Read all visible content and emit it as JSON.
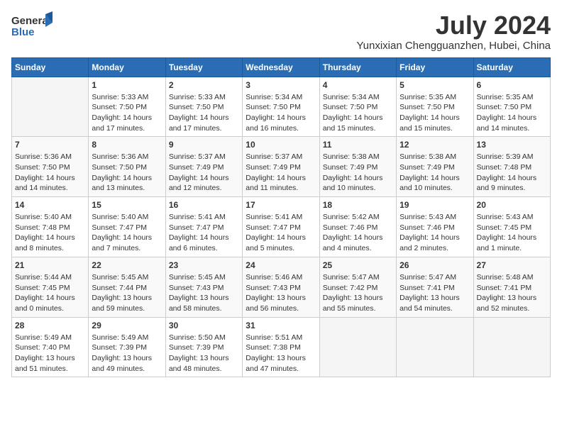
{
  "header": {
    "logo_general": "General",
    "logo_blue": "Blue",
    "title": "July 2024",
    "subtitle": "Yunxixian Chengguanzhen, Hubei, China"
  },
  "calendar": {
    "weekdays": [
      "Sunday",
      "Monday",
      "Tuesday",
      "Wednesday",
      "Thursday",
      "Friday",
      "Saturday"
    ],
    "weeks": [
      [
        {
          "day": "",
          "info": ""
        },
        {
          "day": "1",
          "info": "Sunrise: 5:33 AM\nSunset: 7:50 PM\nDaylight: 14 hours\nand 17 minutes."
        },
        {
          "day": "2",
          "info": "Sunrise: 5:33 AM\nSunset: 7:50 PM\nDaylight: 14 hours\nand 17 minutes."
        },
        {
          "day": "3",
          "info": "Sunrise: 5:34 AM\nSunset: 7:50 PM\nDaylight: 14 hours\nand 16 minutes."
        },
        {
          "day": "4",
          "info": "Sunrise: 5:34 AM\nSunset: 7:50 PM\nDaylight: 14 hours\nand 15 minutes."
        },
        {
          "day": "5",
          "info": "Sunrise: 5:35 AM\nSunset: 7:50 PM\nDaylight: 14 hours\nand 15 minutes."
        },
        {
          "day": "6",
          "info": "Sunrise: 5:35 AM\nSunset: 7:50 PM\nDaylight: 14 hours\nand 14 minutes."
        }
      ],
      [
        {
          "day": "7",
          "info": "Sunrise: 5:36 AM\nSunset: 7:50 PM\nDaylight: 14 hours\nand 14 minutes."
        },
        {
          "day": "8",
          "info": "Sunrise: 5:36 AM\nSunset: 7:50 PM\nDaylight: 14 hours\nand 13 minutes."
        },
        {
          "day": "9",
          "info": "Sunrise: 5:37 AM\nSunset: 7:49 PM\nDaylight: 14 hours\nand 12 minutes."
        },
        {
          "day": "10",
          "info": "Sunrise: 5:37 AM\nSunset: 7:49 PM\nDaylight: 14 hours\nand 11 minutes."
        },
        {
          "day": "11",
          "info": "Sunrise: 5:38 AM\nSunset: 7:49 PM\nDaylight: 14 hours\nand 10 minutes."
        },
        {
          "day": "12",
          "info": "Sunrise: 5:38 AM\nSunset: 7:49 PM\nDaylight: 14 hours\nand 10 minutes."
        },
        {
          "day": "13",
          "info": "Sunrise: 5:39 AM\nSunset: 7:48 PM\nDaylight: 14 hours\nand 9 minutes."
        }
      ],
      [
        {
          "day": "14",
          "info": "Sunrise: 5:40 AM\nSunset: 7:48 PM\nDaylight: 14 hours\nand 8 minutes."
        },
        {
          "day": "15",
          "info": "Sunrise: 5:40 AM\nSunset: 7:47 PM\nDaylight: 14 hours\nand 7 minutes."
        },
        {
          "day": "16",
          "info": "Sunrise: 5:41 AM\nSunset: 7:47 PM\nDaylight: 14 hours\nand 6 minutes."
        },
        {
          "day": "17",
          "info": "Sunrise: 5:41 AM\nSunset: 7:47 PM\nDaylight: 14 hours\nand 5 minutes."
        },
        {
          "day": "18",
          "info": "Sunrise: 5:42 AM\nSunset: 7:46 PM\nDaylight: 14 hours\nand 4 minutes."
        },
        {
          "day": "19",
          "info": "Sunrise: 5:43 AM\nSunset: 7:46 PM\nDaylight: 14 hours\nand 2 minutes."
        },
        {
          "day": "20",
          "info": "Sunrise: 5:43 AM\nSunset: 7:45 PM\nDaylight: 14 hours\nand 1 minute."
        }
      ],
      [
        {
          "day": "21",
          "info": "Sunrise: 5:44 AM\nSunset: 7:45 PM\nDaylight: 14 hours\nand 0 minutes."
        },
        {
          "day": "22",
          "info": "Sunrise: 5:45 AM\nSunset: 7:44 PM\nDaylight: 13 hours\nand 59 minutes."
        },
        {
          "day": "23",
          "info": "Sunrise: 5:45 AM\nSunset: 7:43 PM\nDaylight: 13 hours\nand 58 minutes."
        },
        {
          "day": "24",
          "info": "Sunrise: 5:46 AM\nSunset: 7:43 PM\nDaylight: 13 hours\nand 56 minutes."
        },
        {
          "day": "25",
          "info": "Sunrise: 5:47 AM\nSunset: 7:42 PM\nDaylight: 13 hours\nand 55 minutes."
        },
        {
          "day": "26",
          "info": "Sunrise: 5:47 AM\nSunset: 7:41 PM\nDaylight: 13 hours\nand 54 minutes."
        },
        {
          "day": "27",
          "info": "Sunrise: 5:48 AM\nSunset: 7:41 PM\nDaylight: 13 hours\nand 52 minutes."
        }
      ],
      [
        {
          "day": "28",
          "info": "Sunrise: 5:49 AM\nSunset: 7:40 PM\nDaylight: 13 hours\nand 51 minutes."
        },
        {
          "day": "29",
          "info": "Sunrise: 5:49 AM\nSunset: 7:39 PM\nDaylight: 13 hours\nand 49 minutes."
        },
        {
          "day": "30",
          "info": "Sunrise: 5:50 AM\nSunset: 7:39 PM\nDaylight: 13 hours\nand 48 minutes."
        },
        {
          "day": "31",
          "info": "Sunrise: 5:51 AM\nSunset: 7:38 PM\nDaylight: 13 hours\nand 47 minutes."
        },
        {
          "day": "",
          "info": ""
        },
        {
          "day": "",
          "info": ""
        },
        {
          "day": "",
          "info": ""
        }
      ]
    ]
  }
}
